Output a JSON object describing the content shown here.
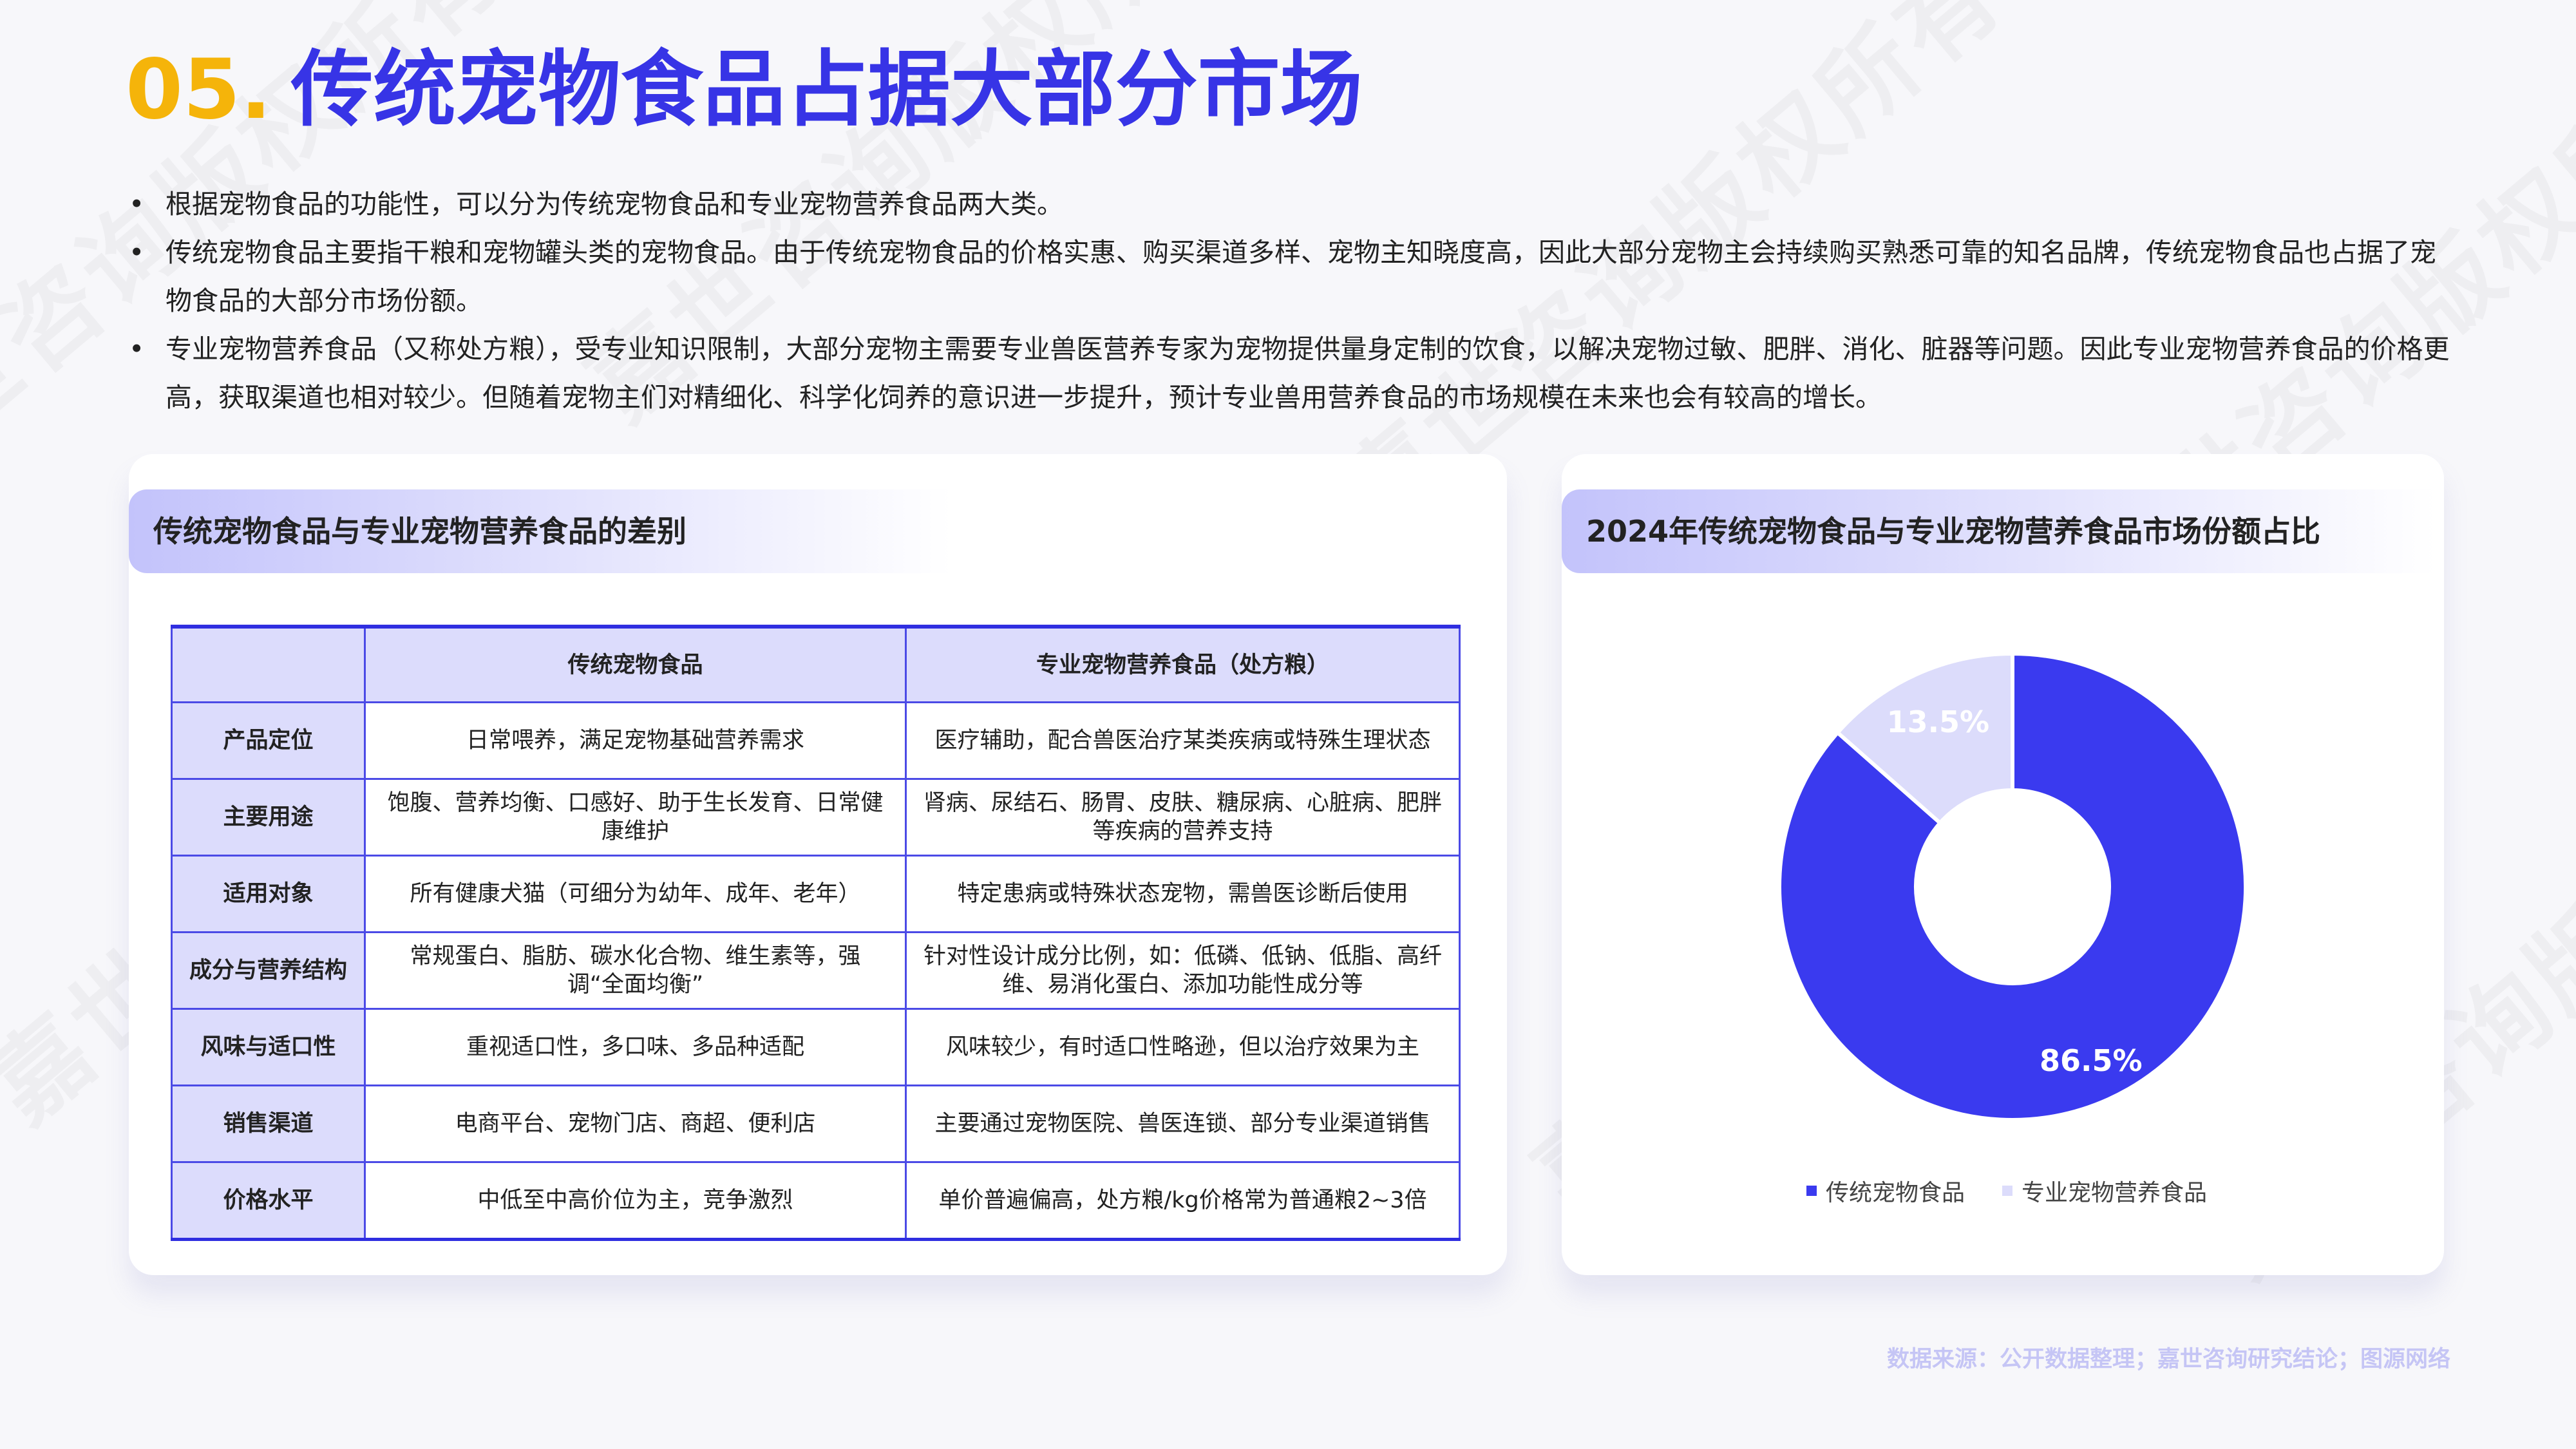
{
  "header": {
    "number": "05.",
    "title": "传统宠物食品占据大部分市场"
  },
  "bullets": [
    "根据宠物食品的功能性，可以分为传统宠物食品和专业宠物营养食品两大类。",
    "传统宠物食品主要指干粮和宠物罐头类的宠物食品。由于传统宠物食品的价格实惠、购买渠道多样、宠物主知晓度高，因此大部分宠物主会持续购买熟悉可靠的知名品牌，传统宠物食品也占据了宠物食品的大部分市场份额。",
    "专业宠物营养食品（又称处方粮），受专业知识限制，大部分宠物主需要专业兽医营养专家为宠物提供量身定制的饮食，以解决宠物过敏、肥胖、消化、脏器等问题。因此专业宠物营养食品的价格更高，获取渠道也相对较少。但随着宠物主们对精细化、科学化饲养的意识进一步提升，预计专业兽用营养食品的市场规模在未来也会有较高的增长。"
  ],
  "left_card": {
    "title": "传统宠物食品与专业宠物营养食品的差别",
    "table": {
      "columns": [
        "",
        "传统宠物食品",
        "专业宠物营养食品（处方粮）"
      ],
      "rows": [
        {
          "label": "产品定位",
          "traditional": "日常喂养，满足宠物基础营养需求",
          "professional": "医疗辅助，配合兽医治疗某类疾病或特殊生理状态"
        },
        {
          "label": "主要用途",
          "traditional": "饱腹、营养均衡、口感好、助于生长发育、日常健康维护",
          "professional": "肾病、尿结石、肠胃、皮肤、糖尿病、心脏病、肥胖等疾病的营养支持"
        },
        {
          "label": "适用对象",
          "traditional": "所有健康犬猫（可细分为幼年、成年、老年）",
          "professional": "特定患病或特殊状态宠物，需兽医诊断后使用"
        },
        {
          "label": "成分与营养结构",
          "traditional": "常规蛋白、脂肪、碳水化合物、维生素等，强调“全面均衡”",
          "professional": "针对性设计成分比例，如：低磷、低钠、低脂、高纤维、易消化蛋白、添加功能性成分等"
        },
        {
          "label": "风味与适口性",
          "traditional": "重视适口性，多口味、多品种适配",
          "professional": "风味较少，有时适口性略逊，但以治疗效果为主"
        },
        {
          "label": "销售渠道",
          "traditional": "电商平台、宠物门店、商超、便利店",
          "professional": "主要通过宠物医院、兽医连锁、部分专业渠道销售"
        },
        {
          "label": "价格水平",
          "traditional": "中低至中高价位为主，竞争激烈",
          "professional": "单价普遍偏高，处方粮/kg价格常为普通粮2~3倍"
        }
      ]
    }
  },
  "right_card": {
    "title": "2024年传统宠物食品与专业宠物营养食品市场份额占比"
  },
  "chart_data": {
    "type": "pie",
    "donut": true,
    "title": "2024年传统宠物食品与专业宠物营养食品市场份额占比",
    "categories": [
      "传统宠物食品",
      "专业宠物营养食品"
    ],
    "values": [
      86.5,
      13.5
    ],
    "labels": [
      "86.5%",
      "13.5%"
    ],
    "colors": [
      "#3a3aef",
      "#dcdcfb"
    ],
    "legend_position": "bottom"
  },
  "watermark": "嘉世咨询版权所有",
  "source": "数据来源：公开数据整理；嘉世咨询研究结论；图源网络"
}
